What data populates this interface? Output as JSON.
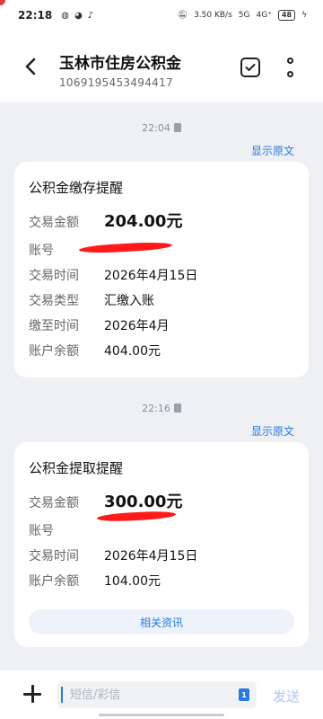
{
  "status_bar": {
    "time": "22:18",
    "net_speed": "3.50 KB/s",
    "signal1": "5G",
    "signal2": "4G⁺",
    "battery": "48"
  },
  "header": {
    "title": "玉林市住房公积金",
    "subtitle": "1069195453494417"
  },
  "messages": [
    {
      "timestamp": "22:04",
      "show_original": "显示原文",
      "card_title": "公积金缴存提醒",
      "rows": [
        {
          "label": "交易金额",
          "value": "204.00元"
        },
        {
          "label": "账号",
          "value": ""
        },
        {
          "label": "交易时间",
          "value": "2026年4月15日"
        },
        {
          "label": "交易类型",
          "value": "汇缴入账"
        },
        {
          "label": "缴至时间",
          "value": "2026年4月"
        },
        {
          "label": "账户余额",
          "value": "404.00元"
        }
      ]
    },
    {
      "timestamp": "22:16",
      "show_original": "显示原文",
      "card_title": "公积金提取提醒",
      "rows": [
        {
          "label": "交易金额",
          "value": "300.00元"
        },
        {
          "label": "账号",
          "value": ""
        },
        {
          "label": "交易时间",
          "value": "2026年4月15日"
        },
        {
          "label": "账户余额",
          "value": "104.00元"
        }
      ],
      "related_button": "相关资讯"
    }
  ],
  "composer": {
    "placeholder": "短信/彩信",
    "send_label": "发送"
  },
  "colors": {
    "accent": "#2a7ae2",
    "background": "#eef0f4",
    "redaction": "#ff1a1a"
  }
}
